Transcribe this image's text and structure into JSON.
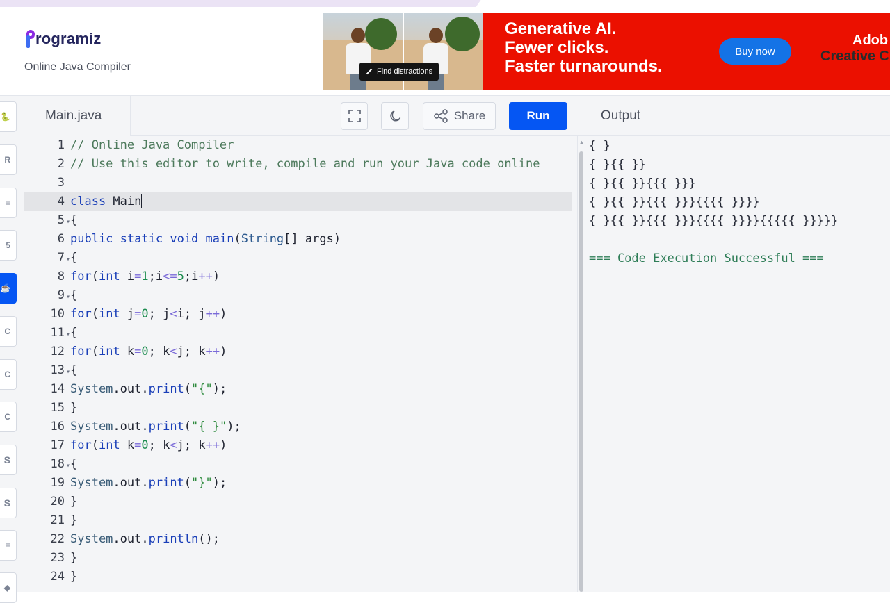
{
  "header": {
    "logo_text": "rogramiz",
    "subtitle": "Online Java Compiler"
  },
  "ad": {
    "find_distractions": "Find distractions",
    "headline": [
      "Generative AI.",
      "Fewer clicks.",
      "Faster turnarounds."
    ],
    "buy_now": "Buy now",
    "brand_line1": "Adob",
    "brand_line2": "Creative C",
    "colors": {
      "background": "#eb1000",
      "button": "#1473e6"
    }
  },
  "sidebar": {
    "items": [
      {
        "icon": "python-icon",
        "label": ""
      },
      {
        "icon": "r-icon",
        "label": ""
      },
      {
        "icon": "database-icon",
        "label": ""
      },
      {
        "icon": "html5-icon",
        "label": ""
      },
      {
        "icon": "java-icon",
        "label": "",
        "active": true
      },
      {
        "icon": "c-icon",
        "label": ""
      },
      {
        "icon": "cpp-icon",
        "label": ""
      },
      {
        "icon": "csharp-icon",
        "label": ""
      },
      {
        "icon": "js-icon",
        "label": "S"
      },
      {
        "icon": "ts-icon",
        "label": "S"
      },
      {
        "icon": "layers-icon",
        "label": ""
      },
      {
        "icon": "php-icon",
        "label": ""
      }
    ]
  },
  "toolbar": {
    "file_name": "Main.java",
    "share_label": "Share",
    "run_label": "Run",
    "accent": "#0556f3"
  },
  "editor": {
    "current_line": 4,
    "lines": [
      {
        "n": "1",
        "fold": false,
        "tokens": [
          [
            "comment",
            "// Online Java Compiler"
          ]
        ]
      },
      {
        "n": "2",
        "fold": false,
        "tokens": [
          [
            "comment",
            "// Use this editor to write, compile and run your Java code online"
          ]
        ]
      },
      {
        "n": "3",
        "fold": false,
        "tokens": []
      },
      {
        "n": "4",
        "fold": false,
        "tokens": [
          [
            "kw",
            "class"
          ],
          [
            "plain",
            " Main"
          ]
        ],
        "cursor": true
      },
      {
        "n": "5",
        "fold": true,
        "tokens": [
          [
            "plain",
            "{"
          ]
        ]
      },
      {
        "n": "6",
        "fold": false,
        "tokens": [
          [
            "kw",
            "public"
          ],
          [
            "plain",
            " "
          ],
          [
            "kw",
            "static"
          ],
          [
            "plain",
            " "
          ],
          [
            "kw",
            "void"
          ],
          [
            "plain",
            " "
          ],
          [
            "fn",
            "main"
          ],
          [
            "plain",
            "("
          ],
          [
            "type",
            "String"
          ],
          [
            "plain",
            "[] args)"
          ]
        ]
      },
      {
        "n": "7",
        "fold": true,
        "tokens": [
          [
            "plain",
            "{"
          ]
        ]
      },
      {
        "n": "8",
        "fold": false,
        "tokens": [
          [
            "kw",
            "for"
          ],
          [
            "plain",
            "("
          ],
          [
            "kw",
            "int"
          ],
          [
            "plain",
            " i"
          ],
          [
            "op",
            "="
          ],
          [
            "num",
            "1"
          ],
          [
            "plain",
            ";i"
          ],
          [
            "op",
            "<="
          ],
          [
            "num",
            "5"
          ],
          [
            "plain",
            ";i"
          ],
          [
            "op",
            "++"
          ],
          [
            "plain",
            ")"
          ]
        ]
      },
      {
        "n": "9",
        "fold": true,
        "tokens": [
          [
            "plain",
            "{"
          ]
        ]
      },
      {
        "n": "10",
        "fold": false,
        "tokens": [
          [
            "kw",
            "for"
          ],
          [
            "plain",
            "("
          ],
          [
            "kw",
            "int"
          ],
          [
            "plain",
            " j"
          ],
          [
            "op",
            "="
          ],
          [
            "num",
            "0"
          ],
          [
            "plain",
            "; j"
          ],
          [
            "op",
            "<"
          ],
          [
            "plain",
            "i; j"
          ],
          [
            "op",
            "++"
          ],
          [
            "plain",
            ")"
          ]
        ]
      },
      {
        "n": "11",
        "fold": true,
        "tokens": [
          [
            "plain",
            "{"
          ]
        ]
      },
      {
        "n": "12",
        "fold": false,
        "tokens": [
          [
            "kw",
            "for"
          ],
          [
            "plain",
            "("
          ],
          [
            "kw",
            "int"
          ],
          [
            "plain",
            " k"
          ],
          [
            "op",
            "="
          ],
          [
            "num",
            "0"
          ],
          [
            "plain",
            "; k"
          ],
          [
            "op",
            "<"
          ],
          [
            "plain",
            "j; k"
          ],
          [
            "op",
            "++"
          ],
          [
            "plain",
            ")"
          ]
        ]
      },
      {
        "n": "13",
        "fold": true,
        "tokens": [
          [
            "plain",
            "{"
          ]
        ]
      },
      {
        "n": "14",
        "fold": false,
        "tokens": [
          [
            "sys",
            "System"
          ],
          [
            "plain",
            ".out."
          ],
          [
            "fn",
            "print"
          ],
          [
            "plain",
            "("
          ],
          [
            "str",
            "\"{\""
          ],
          [
            "plain",
            ");"
          ]
        ]
      },
      {
        "n": "15",
        "fold": false,
        "tokens": [
          [
            "plain",
            "}"
          ]
        ]
      },
      {
        "n": "16",
        "fold": false,
        "tokens": [
          [
            "sys",
            "System"
          ],
          [
            "plain",
            ".out."
          ],
          [
            "fn",
            "print"
          ],
          [
            "plain",
            "("
          ],
          [
            "str",
            "\"{ }\""
          ],
          [
            "plain",
            ");"
          ]
        ]
      },
      {
        "n": "17",
        "fold": false,
        "tokens": [
          [
            "kw",
            "for"
          ],
          [
            "plain",
            "("
          ],
          [
            "kw",
            "int"
          ],
          [
            "plain",
            " k"
          ],
          [
            "op",
            "="
          ],
          [
            "num",
            "0"
          ],
          [
            "plain",
            "; k"
          ],
          [
            "op",
            "<"
          ],
          [
            "plain",
            "j; k"
          ],
          [
            "op",
            "++"
          ],
          [
            "plain",
            ")"
          ]
        ]
      },
      {
        "n": "18",
        "fold": true,
        "tokens": [
          [
            "plain",
            "{"
          ]
        ]
      },
      {
        "n": "19",
        "fold": false,
        "tokens": [
          [
            "sys",
            "System"
          ],
          [
            "plain",
            ".out."
          ],
          [
            "fn",
            "print"
          ],
          [
            "plain",
            "("
          ],
          [
            "str",
            "\"}\""
          ],
          [
            "plain",
            ");"
          ]
        ]
      },
      {
        "n": "20",
        "fold": false,
        "tokens": [
          [
            "plain",
            "}"
          ]
        ]
      },
      {
        "n": "21",
        "fold": false,
        "tokens": [
          [
            "plain",
            "}"
          ]
        ]
      },
      {
        "n": "22",
        "fold": false,
        "tokens": [
          [
            "sys",
            "System"
          ],
          [
            "plain",
            ".out."
          ],
          [
            "fn",
            "println"
          ],
          [
            "plain",
            "();"
          ]
        ]
      },
      {
        "n": "23",
        "fold": false,
        "tokens": [
          [
            "plain",
            "}"
          ]
        ]
      },
      {
        "n": "24",
        "fold": false,
        "tokens": [
          [
            "plain",
            "}"
          ]
        ]
      }
    ]
  },
  "output": {
    "title": "Output",
    "lines": [
      "{ }",
      "{ }{{ }}",
      "{ }{{ }}{{{ }}}",
      "{ }{{ }}{{{ }}}{{{{ }}}}",
      "{ }{{ }}{{{ }}}{{{{ }}}}{{{{{ }}}}}",
      "",
      "=== Code Execution Successful ==="
    ]
  }
}
